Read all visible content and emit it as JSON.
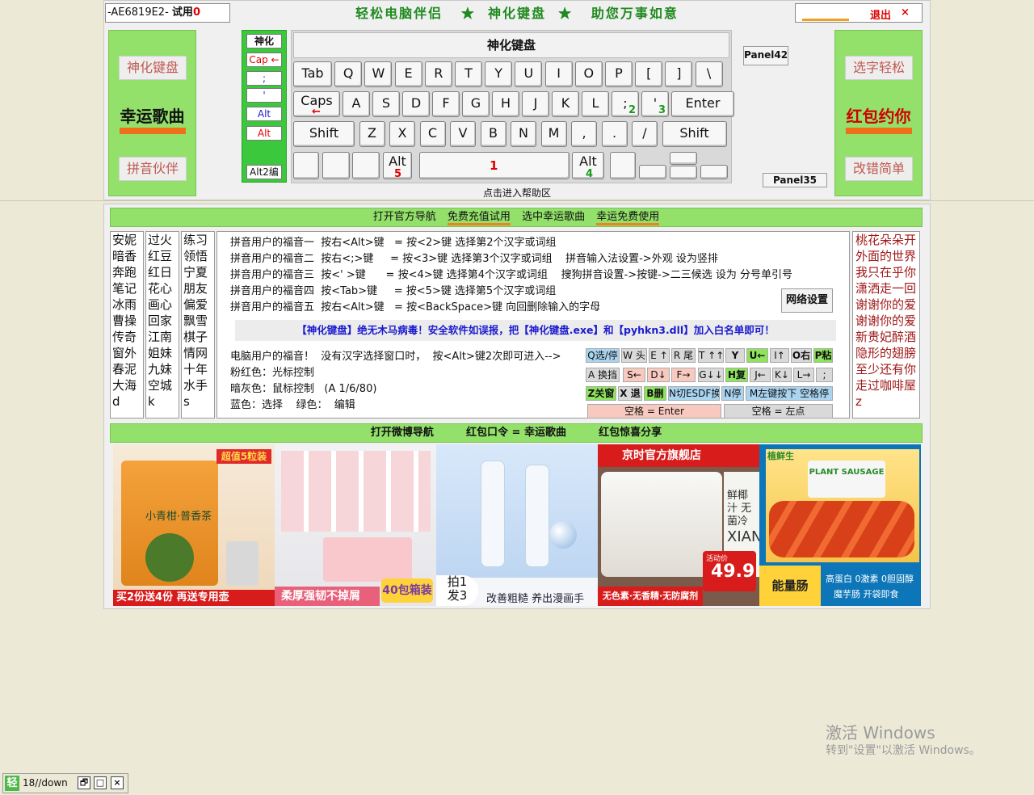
{
  "header": {
    "serial": "-AE6819E2-",
    "trial_label": "试用",
    "trial_count": "0",
    "slogan": "轻松电脑伴侣   ★  神化键盘  ★   助您万事如意",
    "exit_label": "退出",
    "close_glyph": "×"
  },
  "left_panel": {
    "top_button": "神化键盘",
    "highlight": "幸运歌曲",
    "bottom_button": "拼音伙伴"
  },
  "right_panel": {
    "top_button": "选字轻松",
    "highlight": "红包约你",
    "bottom_button": "改错简单"
  },
  "mode_panel": {
    "title": "神化",
    "buttons": [
      "Cap ←",
      ";",
      "'",
      "Alt",
      "Alt"
    ],
    "footer": "Alt2编"
  },
  "keyboard": {
    "title": "神化键盘",
    "row1": [
      "Tab",
      "Q",
      "W",
      "E",
      "R",
      "T",
      "Y",
      "U",
      "I",
      "O",
      "P",
      "[",
      "]",
      "\\"
    ],
    "row2": [
      "Caps",
      "A",
      "S",
      "D",
      "F",
      "G",
      "H",
      "J",
      "K",
      "L",
      ";",
      "'",
      "Enter"
    ],
    "row3": [
      "Shift",
      "Z",
      "X",
      "C",
      "V",
      "B",
      "N",
      "M",
      ",",
      ".",
      "/",
      "Shift"
    ],
    "caps_arrow": "←",
    "semicolon_sub": "2",
    "quote_sub": "3",
    "alt_left": "Alt",
    "alt_left_sub": "5",
    "space_sub": "1",
    "alt_right": "Alt",
    "alt_right_sub": "4"
  },
  "help_label": "点击进入帮助区",
  "panel42": "Panel42",
  "panel35": "Panel35",
  "nav_top": [
    "打开官方导航",
    "免费充值试用",
    "选中幸运歌曲",
    "幸运免费使用"
  ],
  "word_columns": [
    [
      "安妮",
      "暗香",
      "奔跑",
      "笔记",
      "冰雨",
      "曹操",
      "传奇",
      "窗外",
      "春泥",
      "大海",
      "d"
    ],
    [
      "过火",
      "红豆",
      "红日",
      "花心",
      "画心",
      "回家",
      "江南",
      "姐妹",
      "九妹",
      "空城",
      "k"
    ],
    [
      "练习",
      "领悟",
      "宁夏",
      "朋友",
      "偏爱",
      "飘雪",
      "棋子",
      "情网",
      "十年",
      "水手",
      "s"
    ]
  ],
  "info": {
    "lines": [
      "拼音用户的福音一  按右<Alt>键   = 按<2>键 选择第2个汉字或词组",
      "拼音用户的福音二  按右<;>键     = 按<3>键 选择第3个汉字或词组    拼音输入法设置->外观 设为竖排",
      "拼音用户的福音三  按<' >键      = 按<4>键 选择第4个汉字或词组    搜狗拼音设置->按键->二三候选 设为 分号单引号",
      "拼音用户的福音四  按<Tab>键     = 按<5>键 选择第5个汉字或词组",
      "拼音用户的福音五  按右<Alt>键   = 按<BackSpace>键 向回删除输入的字母"
    ],
    "virus_notice": "【神化键盘】绝无木马病毒！安全软件如误报，把【神化键盘.exe】和【pyhkn3.dll】加入白名单即可！",
    "pc_line": "电脑用户的福音！  没有汉字选择窗口时，  按<Alt>键2次即可进入-->",
    "pink_line": "粉红色：光标控制",
    "grey_line": "暗灰色：鼠标控制   (A 1/6/80)",
    "blue_line": "蓝色：选择    绿色：  编辑",
    "net_button": "网络设置"
  },
  "commands": {
    "row1": [
      "Q选/停",
      "W 头",
      "E ↑",
      "R 尾",
      "T ↑↑",
      "Y",
      "U←",
      "I↑",
      "O右",
      "P粘"
    ],
    "row2": [
      "A 换挡",
      "S←",
      "D↓",
      "F→",
      "G↓↓",
      "H复",
      "J←",
      "K↓",
      "L→",
      ";"
    ],
    "row3": [
      "Z关窗",
      "X 退",
      "B删",
      "N切ESDF换",
      "N停",
      "M左键按下 空格停"
    ],
    "space_enter": "空格 = Enter",
    "space_left": "空格 = 左点"
  },
  "right_list": [
    "桃花朵朵开",
    "外面的世界",
    "我只在乎你",
    "潇洒走一回",
    "谢谢你的爱",
    "谢谢你的爱",
    "新贵妃醉酒",
    "隐形的翅膀",
    "至少还有你",
    "走过咖啡屋",
    "z"
  ],
  "nav_bottom": [
    "打开微博导航",
    "红包口令 = 幸运歌曲",
    "红包惊喜分享"
  ],
  "ads": [
    {
      "badge": "超值5粒装",
      "brand": "小青柑·普香茶",
      "footer": "买2份送4份 再送专用壶"
    },
    {
      "footer": "柔厚强韧不掉屑",
      "tag": "40包箱装"
    },
    {
      "left_tag_top": "拍1",
      "left_tag_bottom": "发3",
      "footer": "改善粗糙 养出漫画手"
    },
    {
      "header": "京时官方旗舰店",
      "side": "鲜椰汁 无菌冷",
      "mark": "XIAN",
      "price_label": "活动价",
      "price": "49.9",
      "footer": "无色素·无香精·无防腐剂"
    },
    {
      "logo": "植鲜生",
      "pack_text": "PLANT SAUSAGE",
      "footer_left": "能量肠",
      "footer_right_1": "高蛋白 0激素 0胆固醇",
      "footer_right_2": "魔芋肠   开袋即食"
    }
  ],
  "activation": {
    "title": "激活 Windows",
    "subtitle": "转到\"设置\"以激活 Windows。"
  },
  "taskbar": {
    "logo": "轻",
    "label": "18//down",
    "restore": "🗗",
    "maximize": "□",
    "close": "×"
  }
}
